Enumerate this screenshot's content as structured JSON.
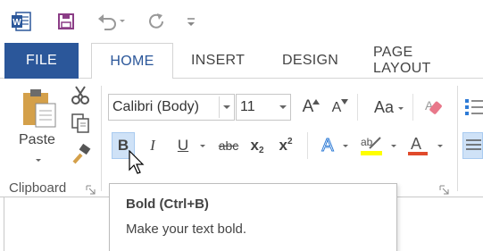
{
  "qat": {
    "app_icon_letter": "W",
    "save_icon": "save-icon",
    "undo_icon": "undo-icon",
    "redo_icon": "redo-icon",
    "customize_icon": "customize-qat-icon"
  },
  "tabs": [
    {
      "label": "FILE"
    },
    {
      "label": "HOME"
    },
    {
      "label": "INSERT"
    },
    {
      "label": "DESIGN"
    },
    {
      "label": "PAGE LAYOUT"
    }
  ],
  "clipboard": {
    "paste_label": "Paste",
    "group_label": "Clipboard"
  },
  "font": {
    "font_name": "Calibri (Body)",
    "font_size": "11",
    "grow_label": "A",
    "shrink_label": "A",
    "case_label": "Aa",
    "bold_label": "B",
    "italic_label": "I",
    "underline_label": "U",
    "strike_label": "abc",
    "subscript_label": "x",
    "subscript_sub": "2",
    "superscript_label": "x",
    "superscript_sup": "2",
    "effects_label": "A",
    "highlight_label": "ab",
    "fontcolor_label": "A"
  },
  "tooltip": {
    "title": "Bold (Ctrl+B)",
    "body": "Make your text bold."
  },
  "colors": {
    "file_tab": "#2b579a",
    "word_blue": "#2b579a",
    "highlight_yellow": "#ffff00",
    "font_color_red": "#e04a2b",
    "text_effects_blue": "#2e7bd6"
  }
}
